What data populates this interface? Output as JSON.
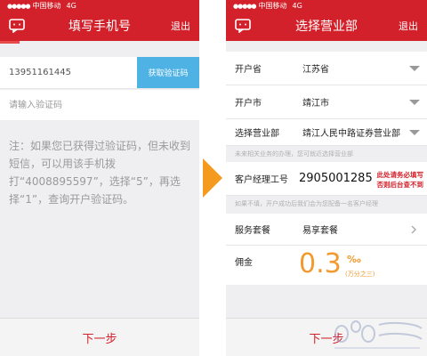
{
  "status_bar": {
    "carrier": "中国移动",
    "network": "4G"
  },
  "screen1": {
    "title": "填写手机号",
    "exit": "退出",
    "phone_value": "13951161445",
    "get_code_button": "获取验证码",
    "code_placeholder": "请输入验证码",
    "note": "注：如果您已获得过验证码，但未收到短信，可以用该手机拨打“4008895597”，选择“5”，再选择“1”，查询开户验证码。",
    "next_button": "下一步"
  },
  "screen2": {
    "title": "选择营业部",
    "exit": "退出",
    "fields": [
      {
        "label": "开户省",
        "value": "江苏省"
      },
      {
        "label": "开户市",
        "value": "靖江市"
      },
      {
        "label": "选择营业部",
        "value": "靖江人民中路证券营业部"
      }
    ],
    "branch_hint": "未来相关业务的办理，您可就近选择营业部",
    "manager_label": "客户经理工号",
    "manager_value": "2905001285",
    "manager_warning_line1": "此处请务必填写",
    "manager_warning_line2": "否则后台查不到",
    "manager_hint": "如果不填，开户成功后我们会为您配备一名客户经理",
    "service_label": "服务套餐",
    "service_value": "易享套餐",
    "commission_label": "佣金",
    "commission_value": "0.3",
    "commission_unit": "‰",
    "commission_unit_text": "(万分之三)",
    "next_button": "下一步"
  },
  "colors": {
    "brand_red": "#d2212a",
    "button_blue": "#4fb2e5",
    "accent_orange": "#f29a2e"
  },
  "icons": {
    "nav_left": "chat-bubble-icon",
    "transition": "arrow-right-icon",
    "service_more": "chevron-right-icon"
  },
  "progress": {
    "screen1_step_fraction": 0.1
  }
}
